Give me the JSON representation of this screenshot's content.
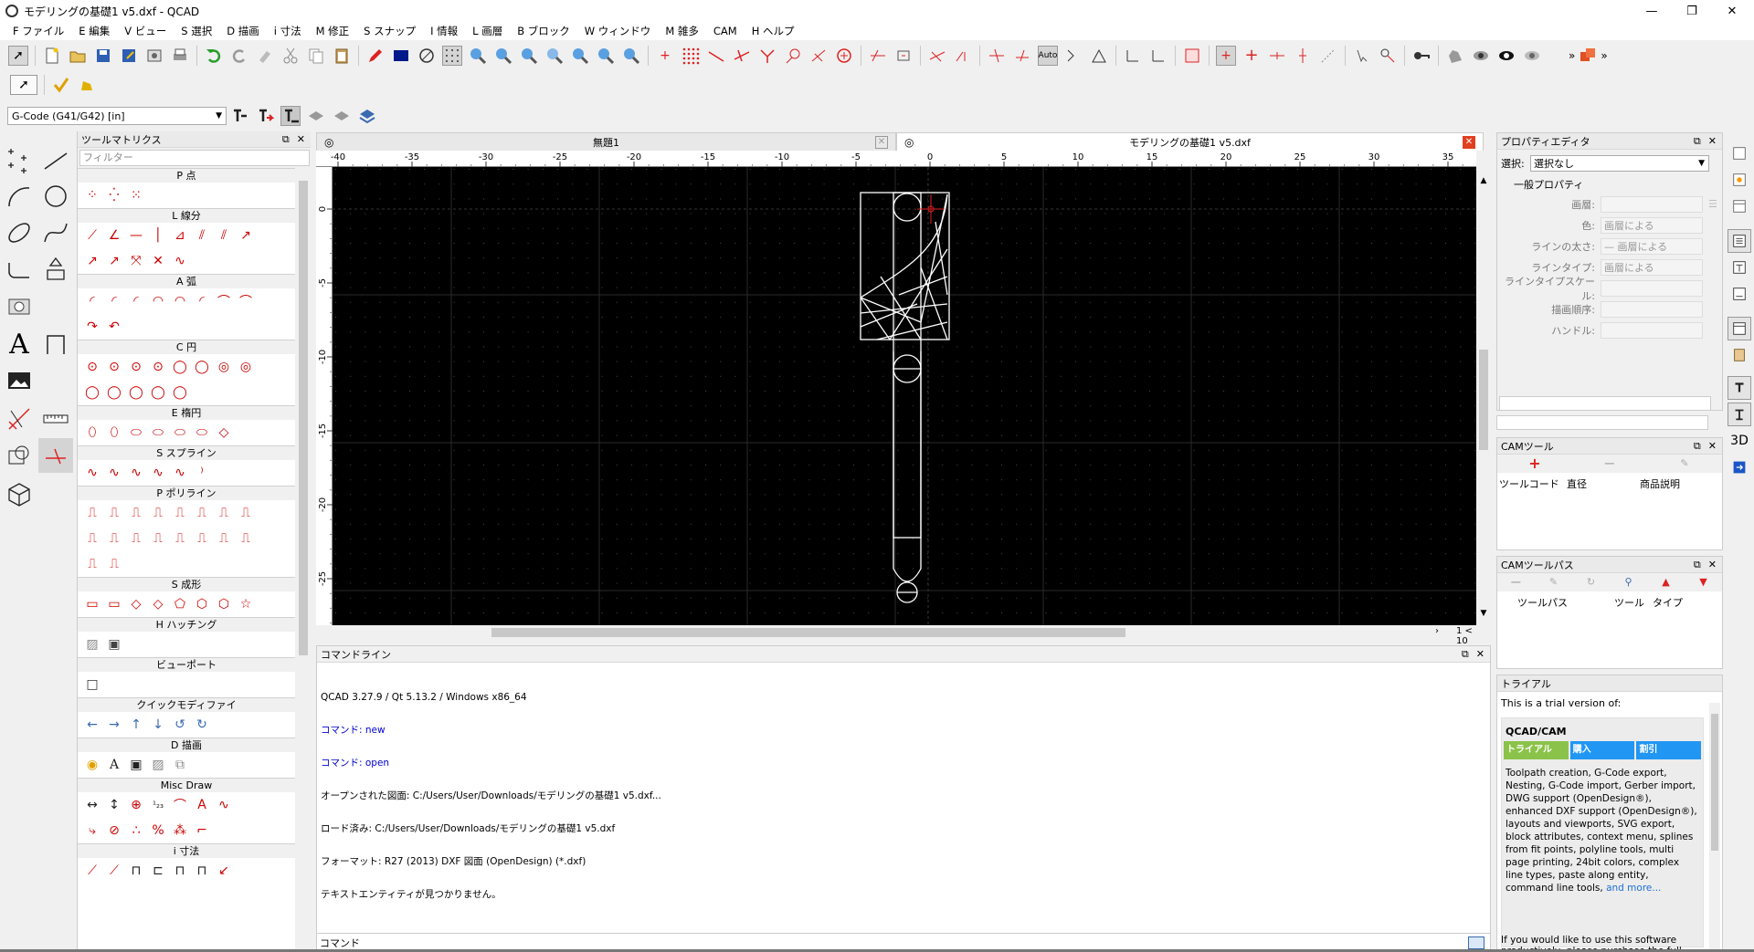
{
  "window": {
    "title": "モデリングの基礎1 v5.dxf - QCAD",
    "minimize": "—",
    "maximize": "❐",
    "close": "✕"
  },
  "menu": [
    "F ファイル",
    "E 編集",
    "V ビュー",
    "S 選択",
    "D 描画",
    "i 寸法",
    "M 修正",
    "S スナップ",
    "I 情報",
    "L 画層",
    "B ブロック",
    "W ウィンドウ",
    "M 雑多",
    "CAM",
    "H ヘルプ"
  ],
  "cam_toolbar": {
    "postprocessor": "G-Code (G41/G42) [in]"
  },
  "tool_matrix": {
    "title": "ツールマトリクス",
    "filter_placeholder": "フィルター",
    "categories": [
      "P 点",
      "L 線分",
      "A 弧",
      "C 円",
      "E 楕円",
      "S スプライン",
      "P ポリライン",
      "S 成形",
      "H ハッチング",
      "ビューポート",
      "クイックモディファイ",
      "D 描画",
      "Misc Draw",
      "i 寸法"
    ]
  },
  "tabs": [
    {
      "label": "無題1"
    },
    {
      "label": "モデリングの基礎1 v5.dxf"
    }
  ],
  "ruler": {
    "h_ticks": [
      "-40",
      "-35",
      "-30",
      "-25",
      "-20",
      "-15",
      "-10",
      "-5",
      "0",
      "5",
      "10",
      "15",
      "20",
      "25",
      "30",
      "35"
    ],
    "v_ticks": [
      "0",
      "-5",
      "-10",
      "-15",
      "-20",
      "-25"
    ]
  },
  "page_indicator": "1 < 10",
  "command_line": {
    "title": "コマンドライン",
    "lines": [
      {
        "text": "QCAD 3.27.9 / Qt 5.13.2 / Windows x86_64",
        "style": "normal"
      },
      {
        "text": "コマンド: new",
        "style": "blue"
      },
      {
        "text": "コマンド: open",
        "style": "blue"
      },
      {
        "text": "オープンされた図面: C:/Users/User/Downloads/モデリングの基礎1 v5.dxf...",
        "style": "normal"
      },
      {
        "text": "ロード済み: C:/Users/User/Downloads/モデリングの基礎1 v5.dxf",
        "style": "normal"
      },
      {
        "text": "フォーマット: R27 (2013) DXF 図面 (OpenDesign) (*.dxf)",
        "style": "normal"
      },
      {
        "text": "テキストエンティティが見つかりません。",
        "style": "normal"
      }
    ],
    "input_label": "コマンド"
  },
  "property_editor": {
    "title": "プロパティエディタ",
    "selection_label": "選択:",
    "selection_value": "選択なし",
    "group": "一般プロパティ",
    "rows": [
      {
        "label": "画層:",
        "value": ""
      },
      {
        "label": "色:",
        "value": "画層による"
      },
      {
        "label": "ラインの太さ:",
        "value": "— 画層による"
      },
      {
        "label": "ラインタイプ:",
        "value": "画層による"
      },
      {
        "label": "ラインタイプスケール:",
        "value": ""
      },
      {
        "label": "描画順序:",
        "value": ""
      },
      {
        "label": "ハンドル:",
        "value": ""
      }
    ]
  },
  "cam_tools": {
    "title": "CAMツール",
    "columns": [
      "ツールコード",
      "直径",
      "商品説明"
    ]
  },
  "cam_toolpaths": {
    "title": "CAMツールパス",
    "columns": [
      "ツールパス",
      "ツール",
      "タイプ"
    ]
  },
  "trial": {
    "title": "トライアル",
    "intro": "This is a trial version of:",
    "product": "QCAD/CAM",
    "buttons": [
      "トライアル",
      "購入",
      "割引"
    ],
    "description": "Toolpath creation, G-Code export, Nesting, G-Code import, Gerber import, DWG support (OpenDesign®), enhanced DXF support (OpenDesign®), layouts and viewports, SVG export, block attributes, context menu, splines from fit points, polyline tools, multi page printing, 24bit colors, complex line types, paste along entity, command line tools,",
    "more_link": "and more...",
    "footer": "If you would like to use this software productively, please purchase the full"
  },
  "right_strip_label": "3D",
  "colors": {
    "accent_red": "#e02020",
    "trial_green": "#8bc34a",
    "trial_blue": "#2196f3",
    "link_blue": "#1e6fd9"
  }
}
